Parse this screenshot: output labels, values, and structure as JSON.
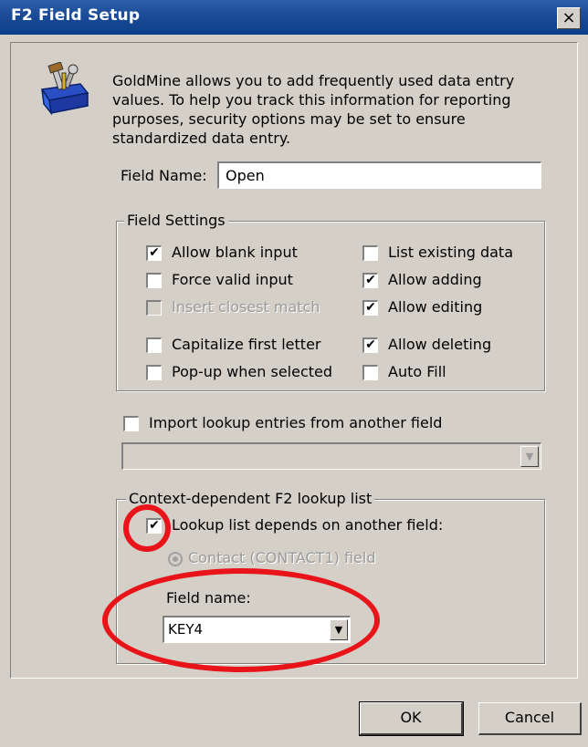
{
  "window": {
    "title": "F2 Field Setup",
    "close_glyph": "×"
  },
  "intro_text": "GoldMine allows you to add frequently used data entry values.  To help you track this information for reporting purposes, security options may be set to ensure standardized data entry.",
  "field_name": {
    "label": "Field Name:",
    "value": "Open"
  },
  "field_settings": {
    "legend": "Field Settings",
    "allow_blank_input": {
      "label": "Allow blank input",
      "checked": true
    },
    "force_valid_input": {
      "label": "Force valid input",
      "checked": false
    },
    "insert_closest_match": {
      "label": "Insert closest match",
      "checked": false,
      "disabled": true
    },
    "capitalize_first_letter": {
      "label": "Capitalize first letter",
      "checked": false
    },
    "popup_when_selected": {
      "label": "Pop-up when selected",
      "checked": false
    },
    "list_existing_data": {
      "label": "List existing data",
      "checked": false
    },
    "allow_adding": {
      "label": "Allow adding",
      "checked": true
    },
    "allow_editing": {
      "label": "Allow editing",
      "checked": true
    },
    "allow_deleting": {
      "label": "Allow deleting",
      "checked": true
    },
    "auto_fill": {
      "label": "Auto Fill",
      "checked": false
    }
  },
  "import_lookup": {
    "label": "Import lookup entries from another field",
    "checked": false,
    "combo_value": ""
  },
  "context_lookup": {
    "legend": "Context-dependent F2 lookup list",
    "depends_label": "Lookup list depends on another field:",
    "depends_checked": true,
    "contact_radio_label": "Contact (CONTACT1) field",
    "field_name_label": "Field name:",
    "field_name_value": "KEY4"
  },
  "buttons": {
    "ok": "OK",
    "cancel": "Cancel"
  },
  "check_glyph": "✔",
  "dropdown_glyph": "▼",
  "icons": {
    "toolbox": "toolbox-icon"
  },
  "colors": {
    "titlebar": "#1b4b96",
    "annotation_circle": "#e8141a",
    "dialog_bg": "#d4d0c8"
  }
}
